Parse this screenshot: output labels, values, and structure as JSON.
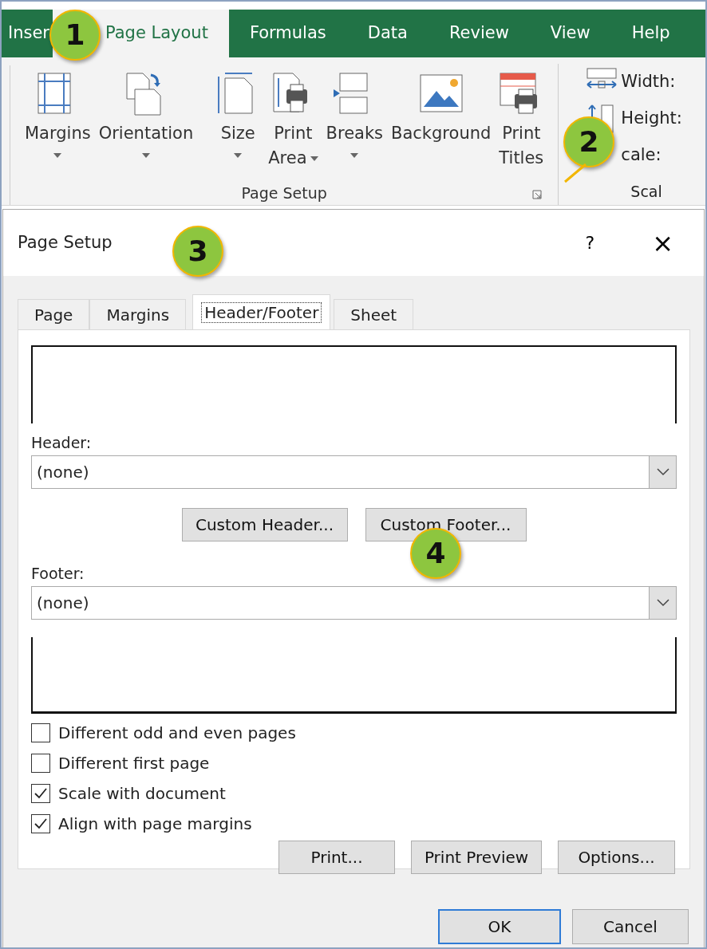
{
  "ribbon_tabs": [
    {
      "label": "Inser",
      "selected": false
    },
    {
      "label": "Page Layout",
      "selected": true
    },
    {
      "label": "Formulas",
      "selected": false
    },
    {
      "label": "Data",
      "selected": false
    },
    {
      "label": "Review",
      "selected": false
    },
    {
      "label": "View",
      "selected": false
    },
    {
      "label": "Help",
      "selected": false
    }
  ],
  "ribbon_commands": [
    {
      "kind": "margins",
      "lines": [
        "Margins"
      ],
      "dropdown": true
    },
    {
      "kind": "orientation",
      "lines": [
        "Orientation"
      ],
      "dropdown": true
    },
    {
      "kind": "size",
      "lines": [
        "Size"
      ],
      "dropdown": true
    },
    {
      "kind": "print-area",
      "lines": [
        "Print",
        "Area"
      ],
      "dropdown": true
    },
    {
      "kind": "breaks",
      "lines": [
        "Breaks"
      ],
      "dropdown": true
    },
    {
      "kind": "background",
      "lines": [
        "Background"
      ],
      "dropdown": false
    },
    {
      "kind": "print-titles",
      "lines": [
        "Print",
        "Titles"
      ],
      "dropdown": false
    }
  ],
  "group_label": "Page Setup",
  "scale_group": {
    "items": [
      {
        "kind": "width",
        "label": "Width:"
      },
      {
        "kind": "height",
        "label": "Height:"
      },
      {
        "kind": "scale",
        "label": "cale:"
      }
    ],
    "label": "Scal"
  },
  "dialog": {
    "title": "Page Setup",
    "help": "?",
    "close": "×",
    "tabs": [
      {
        "label": "Page",
        "selected": false
      },
      {
        "label": "Margins",
        "selected": false
      },
      {
        "label": "Header/Footer",
        "selected": true
      },
      {
        "label": "Sheet",
        "selected": false
      }
    ],
    "header_label": "Header:",
    "header_value": "(none)",
    "custom_buttons": [
      "Custom Header...",
      "Custom Footer..."
    ],
    "footer_label": "Footer:",
    "footer_value": "(none)",
    "options": [
      {
        "label": "Different odd and even pages",
        "checked": false
      },
      {
        "label": "Different first page",
        "checked": false
      },
      {
        "label": "Scale with document",
        "checked": true
      },
      {
        "label": "Align with page margins",
        "checked": true
      }
    ],
    "action_buttons": [
      "Print...",
      "Print Preview",
      "Options..."
    ],
    "footer_buttons": [
      {
        "label": "OK",
        "default": true
      },
      {
        "label": "Cancel",
        "default": false
      }
    ]
  },
  "callouts": [
    "1",
    "2",
    "3",
    "4"
  ]
}
